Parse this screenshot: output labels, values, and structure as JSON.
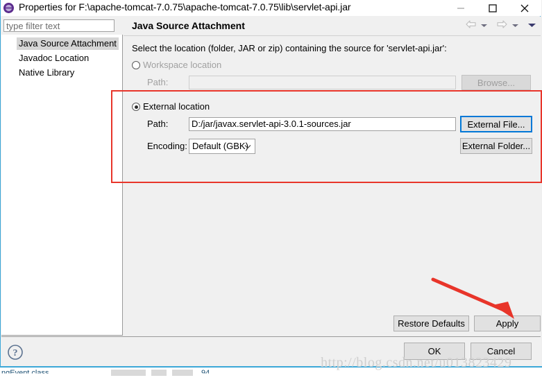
{
  "window": {
    "title": "Properties for F:\\apache-tomcat-7.0.75\\apache-tomcat-7.0.75\\lib\\servlet-api.jar",
    "app_icon": "eclipse-icon",
    "controls": {
      "minimize": "minimize-icon",
      "maximize": "maximize-icon",
      "close": "close-icon"
    }
  },
  "sidebar": {
    "filter_placeholder": "type filter text",
    "filter_value": "",
    "items": [
      {
        "label": "Java Source Attachment",
        "selected": true
      },
      {
        "label": "Javadoc Location",
        "selected": false
      },
      {
        "label": "Native Library",
        "selected": false
      }
    ]
  },
  "page": {
    "title": "Java Source Attachment",
    "description": "Select the location (folder, JAR or zip) containing the source for 'servlet-api.jar':",
    "nav": {
      "back": "back-arrow-icon",
      "back_menu": "chevron-down-icon",
      "forward": "forward-arrow-icon",
      "forward_menu": "chevron-down-icon",
      "view_menu": "chevron-down-icon"
    }
  },
  "workspace_location": {
    "radio_label": "Workspace location",
    "selected": false,
    "path_label": "Path:",
    "path_value": "",
    "browse_label": "Browse...",
    "enabled": false
  },
  "external_location": {
    "radio_label": "External location",
    "selected": true,
    "path_label": "Path:",
    "path_value": "D:/jar/javax.servlet-api-3.0.1-sources.jar",
    "external_file_label": "External File...",
    "external_folder_label": "External Folder...",
    "encoding_label": "Encoding:",
    "encoding_value": "Default (GBK)",
    "encoding_options": [
      "Default (GBK)"
    ]
  },
  "buttons": {
    "restore_defaults": "Restore Defaults",
    "apply": "Apply",
    "ok": "OK",
    "cancel": "Cancel",
    "help": "help-icon"
  },
  "annotations": {
    "highlight_color": "#e8352a",
    "arrow_color": "#e8352a",
    "watermark": "http://blog.csdn.net/u013823429"
  },
  "background": {
    "row_text": "ngEvent.class",
    "row_number": "94"
  }
}
